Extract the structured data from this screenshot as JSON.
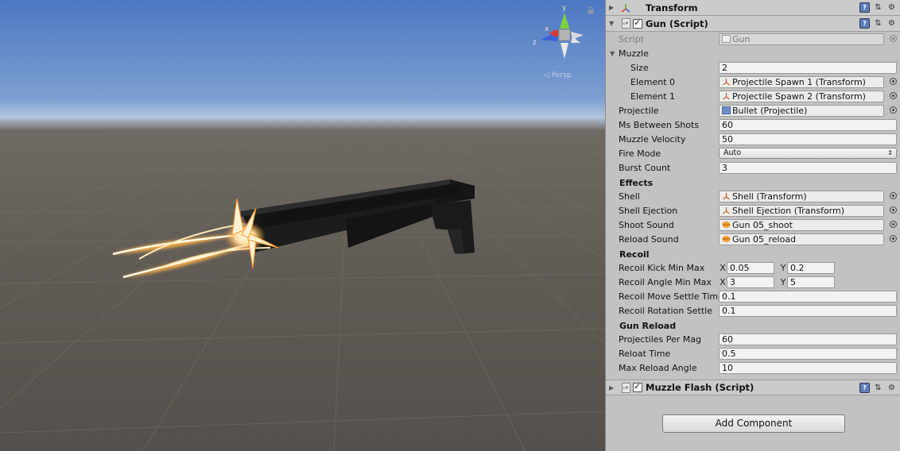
{
  "scene": {
    "persp_label": "◁ Persp",
    "gizmo_axes": {
      "x": "x",
      "y": "y",
      "z": "z"
    },
    "colors": {
      "sky_top": "#4c77c2",
      "horizon": "#b4c5de",
      "ground": "#615b56",
      "gun": "#1b1b1b",
      "flash": "#ffb347"
    }
  },
  "inspector": {
    "transform": {
      "title": "Transform"
    },
    "gun_script": {
      "title": "Gun (Script)",
      "script": {
        "label": "Script",
        "value": "Gun"
      },
      "muzzle": {
        "label": "Muzzle",
        "size_label": "Size",
        "size_value": "2",
        "elements": [
          {
            "label": "Element 0",
            "value": "Projectile Spawn 1 (Transform)"
          },
          {
            "label": "Element 1",
            "value": "Projectile Spawn 2 (Transform)"
          }
        ]
      },
      "projectile": {
        "label": "Projectile",
        "value": "Bullet (Projectile)"
      },
      "ms_between_shots": {
        "label": "Ms Between Shots",
        "value": "60"
      },
      "muzzle_velocity": {
        "label": "Muzzle Velocity",
        "value": "50"
      },
      "fire_mode": {
        "label": "Fire Mode",
        "value": "Auto"
      },
      "burst_count": {
        "label": "Burst Count",
        "value": "3"
      },
      "effects": {
        "header": "Effects",
        "shell": {
          "label": "Shell",
          "value": "Shell (Transform)"
        },
        "shell_ejection": {
          "label": "Shell Ejection",
          "value": "Shell Ejection (Transform)"
        },
        "shoot_sound": {
          "label": "Shoot Sound",
          "value": "Gun 05_shoot"
        },
        "reload_sound": {
          "label": "Reload Sound",
          "value": "Gun 05_reload"
        }
      },
      "recoil": {
        "header": "Recoil",
        "kick": {
          "label": "Recoil Kick Min Max",
          "x": "0.05",
          "y": "0.2"
        },
        "angle": {
          "label": "Recoil Angle Min Max",
          "x": "3",
          "y": "5"
        },
        "move_settle": {
          "label": "Recoil Move Settle Time",
          "value": "0.1"
        },
        "rotation_settle": {
          "label": "Recoil Rotation Settle",
          "value": "0.1"
        }
      },
      "gun_reload": {
        "header": "Gun Reload",
        "projectiles_per_mag": {
          "label": "Projectiles Per Mag",
          "value": "60"
        },
        "reload_time": {
          "label": "Reloat Time",
          "value": "0.5"
        },
        "max_reload_angle": {
          "label": "Max Reload Angle",
          "value": "10"
        }
      },
      "axis_x": "X",
      "axis_y": "Y"
    },
    "muzzle_flash": {
      "title": "Muzzle Flash (Script)"
    },
    "add_component": "Add Component"
  }
}
